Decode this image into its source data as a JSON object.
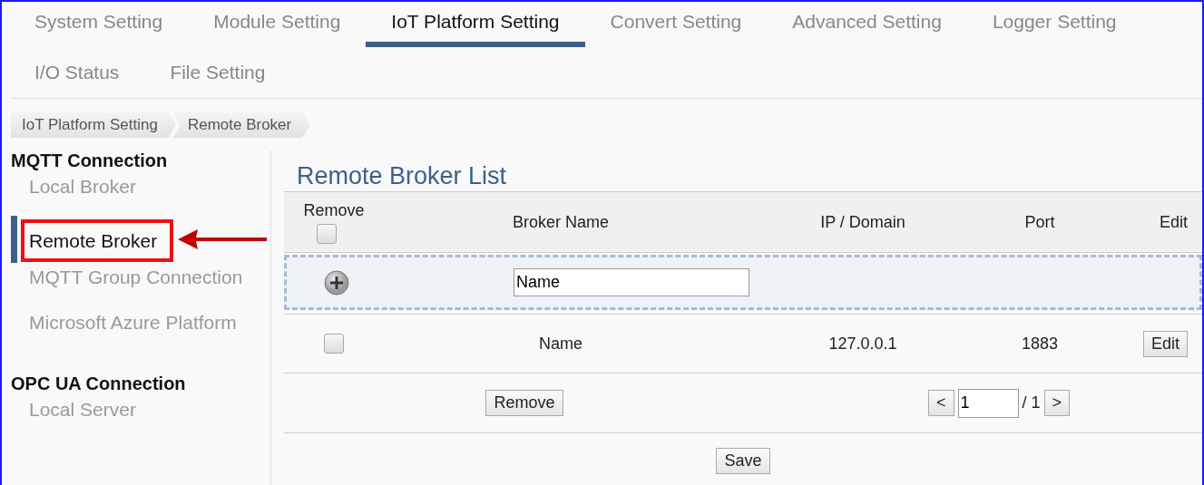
{
  "tabs": [
    {
      "label": "System Setting",
      "selected": false
    },
    {
      "label": "Module Setting",
      "selected": false
    },
    {
      "label": "IoT Platform Setting",
      "selected": true
    },
    {
      "label": "Convert Setting",
      "selected": false
    },
    {
      "label": "Advanced Setting",
      "selected": false
    },
    {
      "label": "Logger Setting",
      "selected": false
    },
    {
      "label": "I/O Status",
      "selected": false
    },
    {
      "label": "File Setting",
      "selected": false
    }
  ],
  "breadcrumb": [
    "IoT Platform Setting",
    "Remote Broker"
  ],
  "sidebar": {
    "groups": [
      {
        "title": "MQTT Connection",
        "items": [
          {
            "label": "Local Broker",
            "selected": false,
            "highlighted": false
          },
          {
            "label": "Remote Broker",
            "selected": true,
            "highlighted": true
          },
          {
            "label": "MQTT Group Connection",
            "selected": false,
            "highlighted": false
          },
          {
            "label": "Microsoft Azure Platform",
            "selected": false,
            "highlighted": false
          }
        ]
      },
      {
        "title": "OPC UA Connection",
        "items": [
          {
            "label": "Local Server",
            "selected": false,
            "highlighted": false
          }
        ]
      }
    ]
  },
  "broker_list": {
    "title": "Remote Broker List",
    "columns": [
      "Remove",
      "Broker Name",
      "IP / Domain",
      "Port",
      "Edit"
    ],
    "select_all_checked": false,
    "new_row": {
      "name_value": "Name"
    },
    "rows": [
      {
        "checked": false,
        "name": "Name",
        "ip": "127.0.0.1",
        "port": "1883",
        "edit_button": "Edit"
      }
    ],
    "remove_button": "Remove",
    "pager": {
      "prev": "<",
      "page": "1",
      "total": "/ 1",
      "next": ">"
    },
    "save_button": "Save"
  }
}
